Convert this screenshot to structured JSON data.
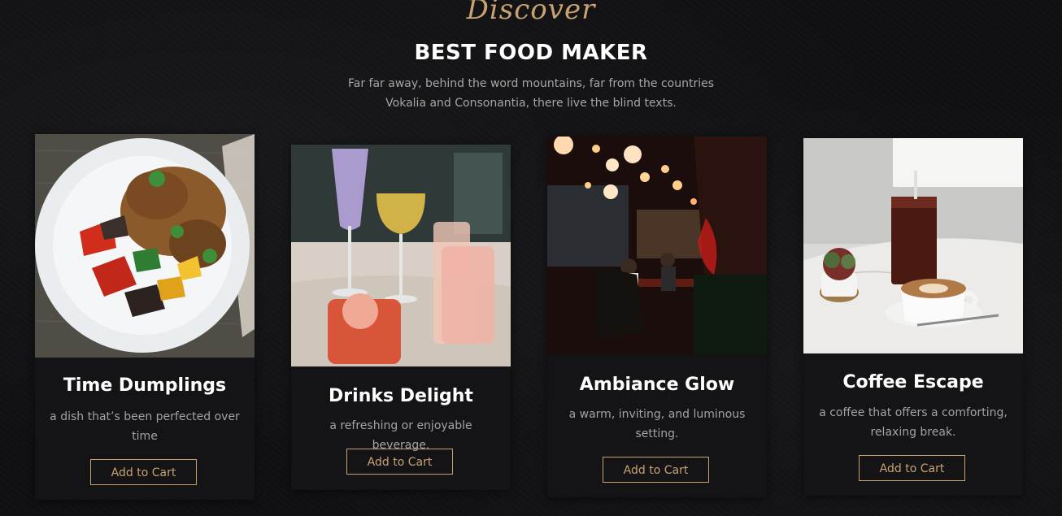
{
  "section": {
    "eyebrow": "Discover",
    "title": "BEST FOOD MAKER",
    "subtitle": "Far far away, behind the word mountains, far from the countries Vokalia and Consonantia, there live the blind texts."
  },
  "cards": [
    {
      "title": "Time Dumplings",
      "description": "a dish that’s been perfected over time",
      "button_label": "Add to Cart",
      "image": "plated-curry-with-peppers-photo"
    },
    {
      "title": "Drinks Delight",
      "description": "a refreshing or enjoyable beverage.",
      "button_label": "Add to Cart",
      "image": "cocktail-glasses-photo"
    },
    {
      "title": "Ambiance Glow",
      "description": "a warm, inviting, and luminous setting.",
      "button_label": "Add to Cart",
      "image": "night-terrace-lanterns-photo"
    },
    {
      "title": "Coffee Escape",
      "description": "a coffee that offers a comforting, relaxing break.",
      "button_label": "Add to Cart",
      "image": "latte-and-iced-coffee-photo"
    }
  ],
  "colors": {
    "accent": "#c8a371",
    "background": "#101012",
    "card": "#141316"
  }
}
